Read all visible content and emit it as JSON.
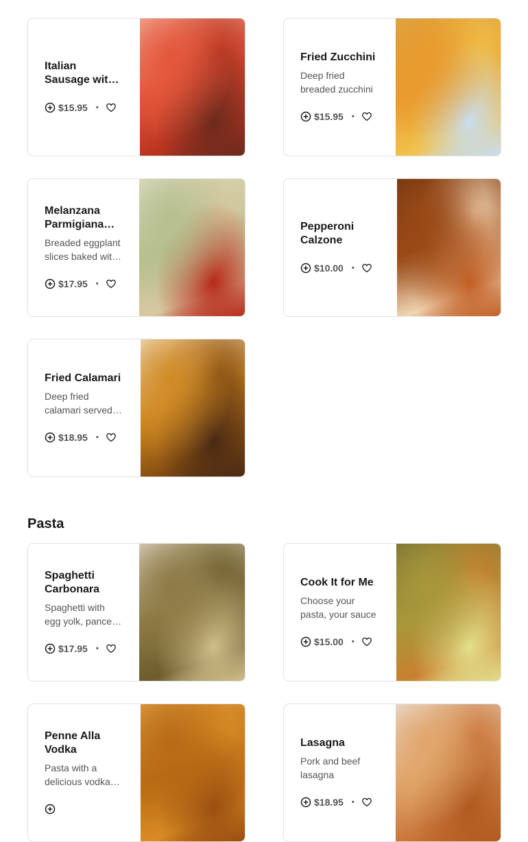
{
  "sections": [
    {
      "name": "",
      "items": [
        {
          "title": "Italian Sausage with Peppers",
          "desc": "",
          "price": "$15.95",
          "colors": [
            "#f7b9a8",
            "#e3563a",
            "#b9341f",
            "#6b2a1d"
          ]
        },
        {
          "title": "Fried Zucchini",
          "desc": "Deep fried breaded zucchini",
          "price": "$15.95",
          "colors": [
            "#d9a54a",
            "#e89a2c",
            "#f2c24a",
            "#c8ddee"
          ]
        },
        {
          "title": "Melanzana Parmigiana Appetizer",
          "desc": "Breaded eggplant slices baked with cheese",
          "price": "$17.95",
          "colors": [
            "#e6e3cf",
            "#b6bf8f",
            "#d9c9a0",
            "#b82a1a"
          ]
        },
        {
          "title": "Pepperoni Calzone",
          "desc": "",
          "price": "$10.00",
          "colors": [
            "#6a3210",
            "#9a4a17",
            "#f0d4b2",
            "#c15f25"
          ]
        },
        {
          "title": "Fried Calamari",
          "desc": "Deep fried calamari served with marinara",
          "price": "$18.95",
          "colors": [
            "#f6eddf",
            "#d08a24",
            "#8a5011",
            "#4a2a14"
          ]
        }
      ]
    },
    {
      "name": "Pasta",
      "items": [
        {
          "title": "Spaghetti Carbonara",
          "desc": "Spaghetti with egg yolk, pancetta and pecorino",
          "price": "$17.95",
          "colors": [
            "#eee8e0",
            "#8d7a45",
            "#6d5d2c",
            "#cfbd8a"
          ]
        },
        {
          "title": "Cook It for Me",
          "desc": "Choose your pasta, your sauce",
          "price": "$15.00",
          "colors": [
            "#6e6a32",
            "#a8973b",
            "#c8802f",
            "#e3df8c"
          ]
        },
        {
          "title": "Penne Alla Vodka",
          "desc": "Pasta with a delicious vodka sauce",
          "price": "",
          "colors": [
            "#e2a44c",
            "#b96a14",
            "#d98c24",
            "#9a4e10"
          ]
        },
        {
          "title": "Lasagna",
          "desc": "Pork and beef lasagna",
          "price": "$18.95",
          "colors": [
            "#ecebf1",
            "#e0a56a",
            "#c9763a",
            "#b05a20"
          ]
        }
      ]
    }
  ]
}
